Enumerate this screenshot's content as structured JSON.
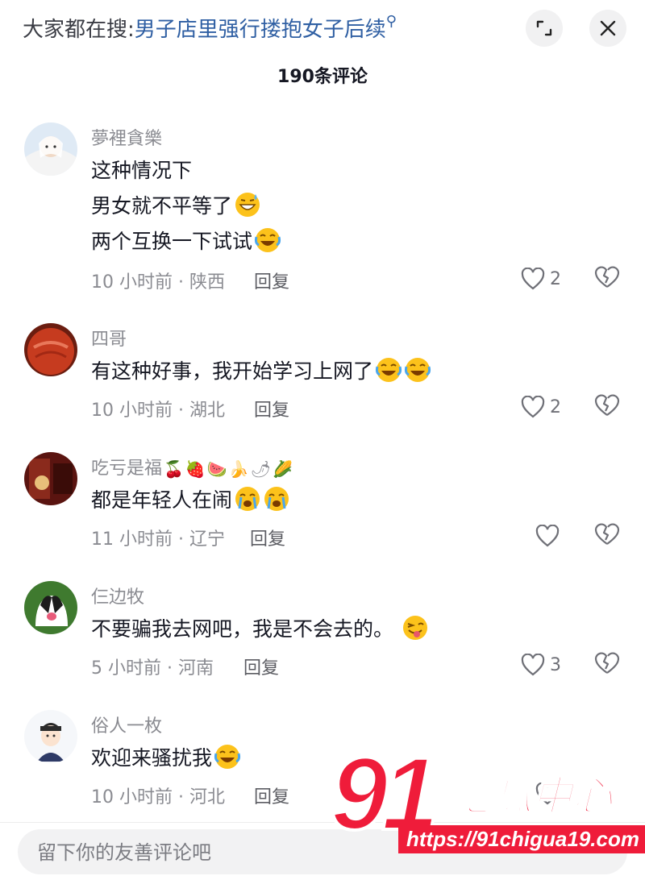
{
  "header": {
    "trend_prefix": "大家都在搜:",
    "trend_query": "男子店里强行搂抱女子后续",
    "expand_icon": "expand-icon",
    "close_icon": "close-icon",
    "comment_count": "190条评论"
  },
  "comments": [
    {
      "user": "夢裡貪樂",
      "lines": [
        "这种情况下",
        "男女就不平等了",
        "两个互换一下试试"
      ],
      "time": "10 小时前 · 陕西",
      "reply": "回复",
      "likes": "2"
    },
    {
      "user": "四哥",
      "lines": [
        "有这种好事，我开始学习上网了"
      ],
      "time": "10 小时前 · 湖北",
      "reply": "回复",
      "likes": "2"
    },
    {
      "user": "吃亏是福",
      "lines": [
        "都是年轻人在闹"
      ],
      "time": "11 小时前 · 辽宁",
      "reply": "回复",
      "likes": ""
    },
    {
      "user": "仨边牧",
      "lines": [
        "不要骗我去网吧，我是不会去的。"
      ],
      "time": "5 小时前 · 河南",
      "reply": "回复",
      "likes": "3"
    },
    {
      "user": "俗人一枚",
      "lines": [
        "欢迎来骚扰我"
      ],
      "time": "10 小时前 · 河北",
      "reply": "回复",
      "likes": ""
    }
  ],
  "input": {
    "placeholder": "留下你的友善评论吧"
  },
  "watermark": {
    "number": "91",
    "title": "吃瓜中心",
    "url": "https://91chigua19.com"
  },
  "colors": {
    "accent": "#2f5fa3",
    "brand": "#ef1c3a"
  }
}
